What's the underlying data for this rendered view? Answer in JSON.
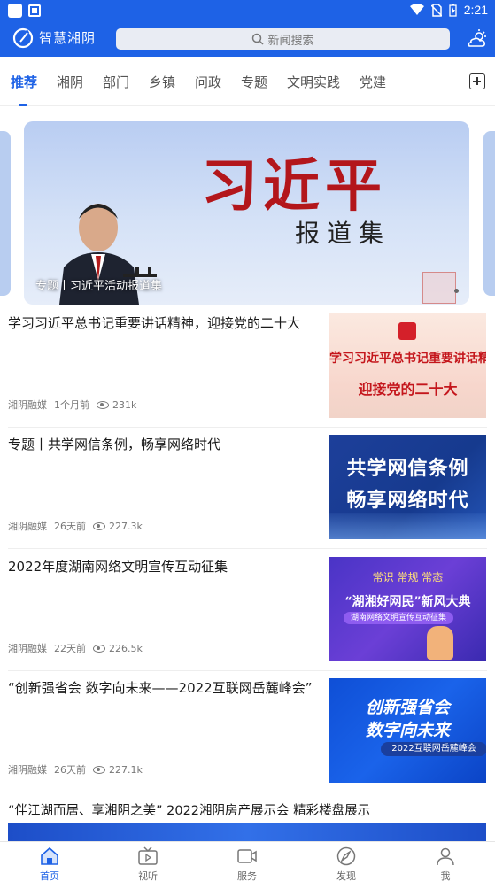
{
  "status_bar": {
    "time": "2:21"
  },
  "header": {
    "app_title": "智慧湘阴",
    "search_placeholder": "新闻搜索"
  },
  "tabs": [
    {
      "label": "推荐",
      "active": true
    },
    {
      "label": "湘阴"
    },
    {
      "label": "部门"
    },
    {
      "label": "乡镇"
    },
    {
      "label": "问政"
    },
    {
      "label": "专题"
    },
    {
      "label": "文明实践"
    },
    {
      "label": "党建"
    }
  ],
  "banner": {
    "title_text": "习近平",
    "subtitle_text": "报道集",
    "caption": "专题丨习近平活动报道集"
  },
  "news": [
    {
      "title": "学习习近平总书记重要讲话精神，迎接党的二十大",
      "source": "湘阴融媒",
      "time": "1个月前",
      "views": "231k",
      "thumb_line1": "学习习近平总书记重要讲话精神",
      "thumb_line2": "迎接党的二十大"
    },
    {
      "title": "专题丨共学网信条例，畅享网络时代",
      "source": "湘阴融媒",
      "time": "26天前",
      "views": "227.3k",
      "thumb_line1": "共学网信条例",
      "thumb_line2": "畅享网络时代"
    },
    {
      "title": "2022年度湖南网络文明宣传互动征集",
      "source": "湘阴融媒",
      "time": "22天前",
      "views": "226.5k",
      "thumb_line1": "常识 常规 常态",
      "thumb_line2": "“湖湘好网民”新风大典",
      "thumb_line3": "湖南网络文明宣传互动征集"
    },
    {
      "title": "“创新强省会 数字向未来——2022互联网岳麓峰会”",
      "source": "湘阴融媒",
      "time": "26天前",
      "views": "227.1k",
      "thumb_line1": "创新强省会",
      "thumb_line2": "数字向未来",
      "thumb_line3": "2022互联网岳麓峰会"
    }
  ],
  "last_news": {
    "title": "“伴江湖而居、享湘阴之美” 2022湘阴房产展示会 精彩楼盘展示"
  },
  "bottom_nav": [
    {
      "label": "首页",
      "icon": "home-icon",
      "active": true
    },
    {
      "label": "视听",
      "icon": "tv-icon"
    },
    {
      "label": "服务",
      "icon": "video-icon"
    },
    {
      "label": "发现",
      "icon": "compass-icon"
    },
    {
      "label": "我",
      "icon": "user-icon"
    }
  ],
  "colors": {
    "brand": "#1e62e6",
    "tab_active": "#1e62e6"
  }
}
